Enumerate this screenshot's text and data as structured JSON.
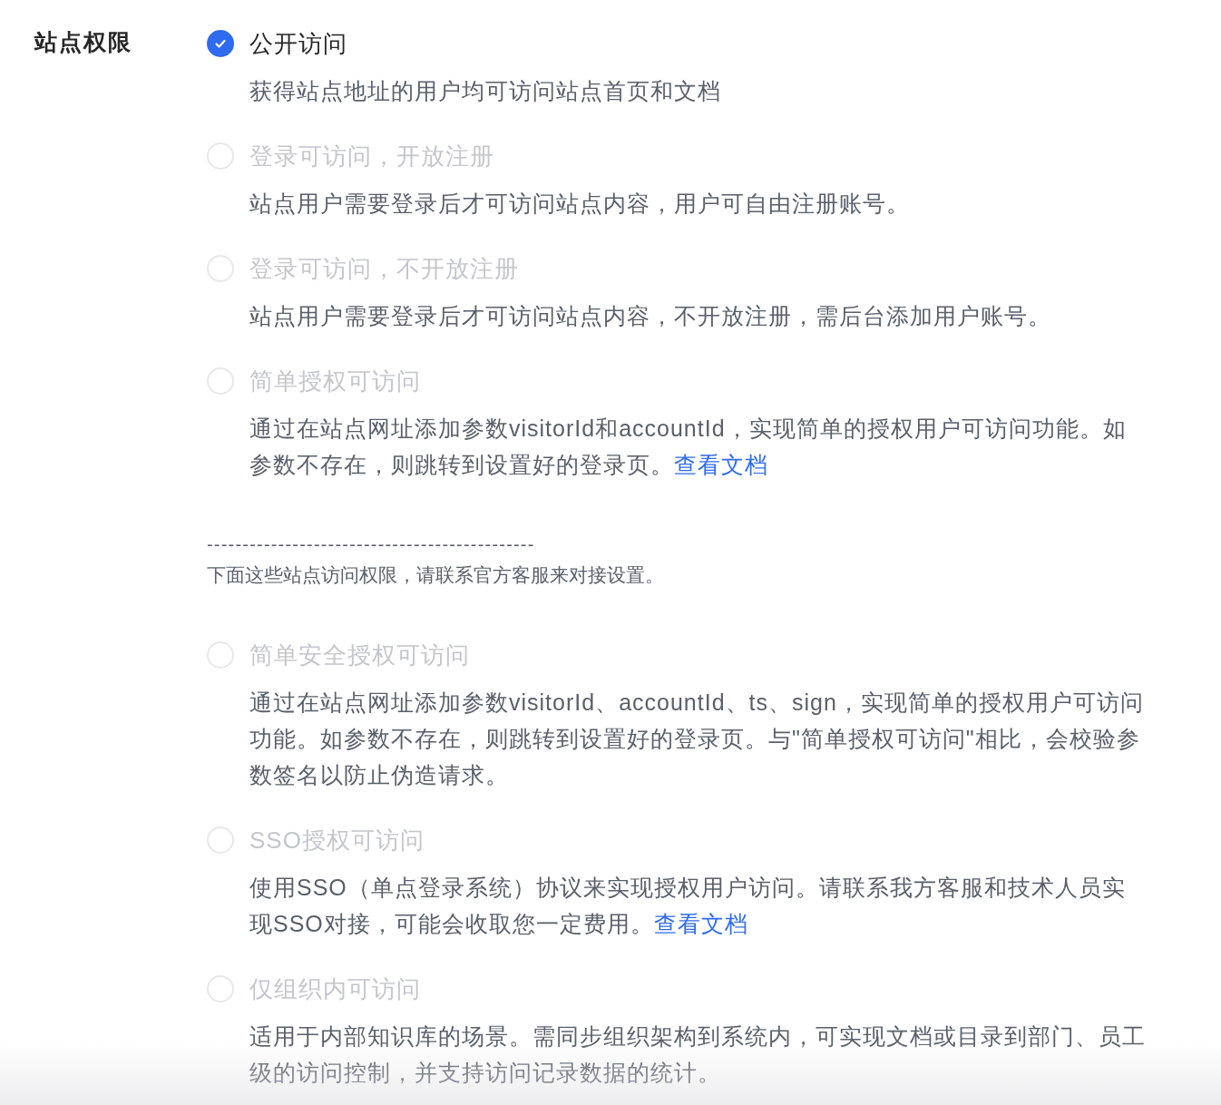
{
  "section_label": "站点权限",
  "items": [
    {
      "kind": "option",
      "label": "公开访问",
      "selected": true,
      "disabled": false,
      "description": "获得站点地址的用户均可访问站点首页和文档"
    },
    {
      "kind": "option",
      "label": "登录可访问，开放注册",
      "selected": false,
      "disabled": true,
      "description": "站点用户需要登录后才可访问站点内容，用户可自由注册账号。"
    },
    {
      "kind": "option",
      "label": "登录可访问，不开放注册",
      "selected": false,
      "disabled": true,
      "description": "站点用户需要登录后才可访问站点内容，不开放注册，需后台添加用户账号。"
    },
    {
      "kind": "option",
      "label": "简单授权可访问",
      "selected": false,
      "disabled": true,
      "description": "通过在站点网址添加参数visitorId和accountId，实现简单的授权用户可访问功能。如参数不存在，则跳转到设置好的登录页。",
      "link": "查看文档"
    },
    {
      "kind": "note",
      "divider": "----------------------------------------------",
      "text": "下面这些站点访问权限，请联系官方客服来对接设置。"
    },
    {
      "kind": "option",
      "label": "简单安全授权可访问",
      "selected": false,
      "disabled": true,
      "description": "通过在站点网址添加参数visitorId、accountId、ts、sign，实现简单的授权用户可访问功能。如参数不存在，则跳转到设置好的登录页。与\"简单授权可访问\"相比，会校验参数签名以防止伪造请求。"
    },
    {
      "kind": "option",
      "label": "SSO授权可访问",
      "selected": false,
      "disabled": true,
      "description": "使用SSO（单点登录系统）协议来实现授权用户访问。请联系我方客服和技术人员实现SSO对接，可能会收取您一定费用。",
      "link": "查看文档"
    },
    {
      "kind": "option",
      "label": "仅组织内可访问",
      "selected": false,
      "disabled": true,
      "description": "适用于内部知识库的场景。需同步组织架构到系统内，可实现文档或目录到部门、员工级的访问控制，并支持访问记录数据的统计。"
    }
  ]
}
